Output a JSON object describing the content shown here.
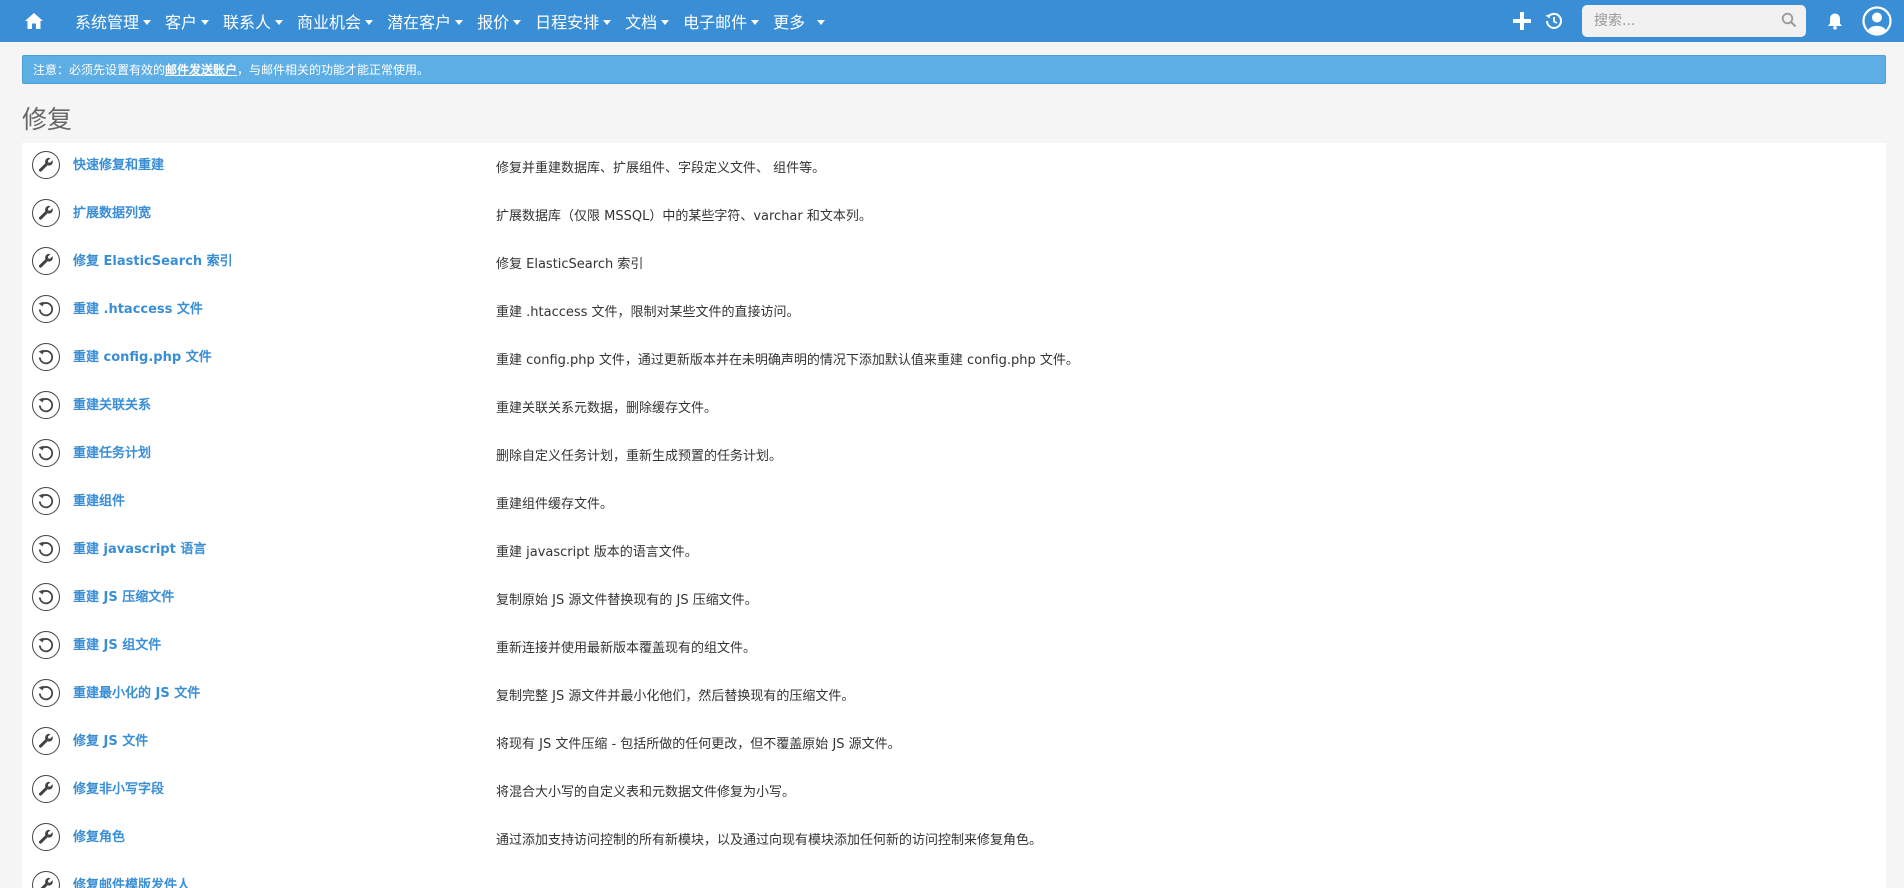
{
  "nav": {
    "items": [
      {
        "label": "系统管理"
      },
      {
        "label": "客户"
      },
      {
        "label": "联系人"
      },
      {
        "label": "商业机会"
      },
      {
        "label": "潜在客户"
      },
      {
        "label": "报价"
      },
      {
        "label": "日程安排"
      },
      {
        "label": "文档"
      },
      {
        "label": "电子邮件"
      },
      {
        "label": "更多"
      }
    ],
    "search_placeholder": "搜索..."
  },
  "notice": {
    "prefix": "注意：必须先设置有效的",
    "link": "邮件发送账户",
    "suffix": "，与邮件相关的功能才能正常使用。"
  },
  "page": {
    "title": "修复"
  },
  "repairs": [
    {
      "icon": "wrench-icon",
      "title": "快速修复和重建",
      "desc": "修复并重建数据库、扩展组件、字段定义文件、 组件等。"
    },
    {
      "icon": "wrench-icon",
      "title": "扩展数据列宽",
      "desc": "扩展数据库（仅限 MSSQL）中的某些字符、varchar 和文本列。"
    },
    {
      "icon": "wrench-icon",
      "title": "修复 ElasticSearch 索引",
      "desc": "修复 ElasticSearch 索引"
    },
    {
      "icon": "rebuild-icon",
      "title": "重建 .htaccess 文件",
      "desc": "重建 .htaccess 文件，限制对某些文件的直接访问。"
    },
    {
      "icon": "rebuild-icon",
      "title": "重建 config.php 文件",
      "desc": "重建 config.php 文件，通过更新版本并在未明确声明的情况下添加默认值来重建 config.php 文件。"
    },
    {
      "icon": "rebuild-icon",
      "title": "重建关联关系",
      "desc": "重建关联关系元数据，删除缓存文件。"
    },
    {
      "icon": "rebuild-icon",
      "title": "重建任务计划",
      "desc": "删除自定义任务计划，重新生成预置的任务计划。"
    },
    {
      "icon": "rebuild-icon",
      "title": "重建组件",
      "desc": "重建组件缓存文件。"
    },
    {
      "icon": "rebuild-icon",
      "title": "重建 javascript 语言",
      "desc": "重建 javascript 版本的语言文件。"
    },
    {
      "icon": "rebuild-icon",
      "title": "重建 JS 压缩文件",
      "desc": "复制原始 JS 源文件替换现有的 JS 压缩文件。"
    },
    {
      "icon": "rebuild-icon",
      "title": "重建 JS 组文件",
      "desc": "重新连接并使用最新版本覆盖现有的组文件。"
    },
    {
      "icon": "rebuild-icon",
      "title": "重建最小化的 JS 文件",
      "desc": "复制完整 JS 源文件并最小化他们，然后替换现有的压缩文件。"
    },
    {
      "icon": "wrench-icon",
      "title": "修复 JS 文件",
      "desc": "将现有 JS 文件压缩 - 包括所做的任何更改，但不覆盖原始 JS 源文件。"
    },
    {
      "icon": "wrench-icon",
      "title": "修复非小写字段",
      "desc": "将混合大小写的自定义表和元数据文件修复为小写。"
    },
    {
      "icon": "wrench-icon",
      "title": "修复角色",
      "desc": "通过添加支持访问控制的所有新模块，以及通过向现有模块添加任何新的访问控制来修复角色。"
    },
    {
      "icon": "wrench-icon",
      "title": "修复邮件模版发件人",
      "desc": ""
    }
  ]
}
